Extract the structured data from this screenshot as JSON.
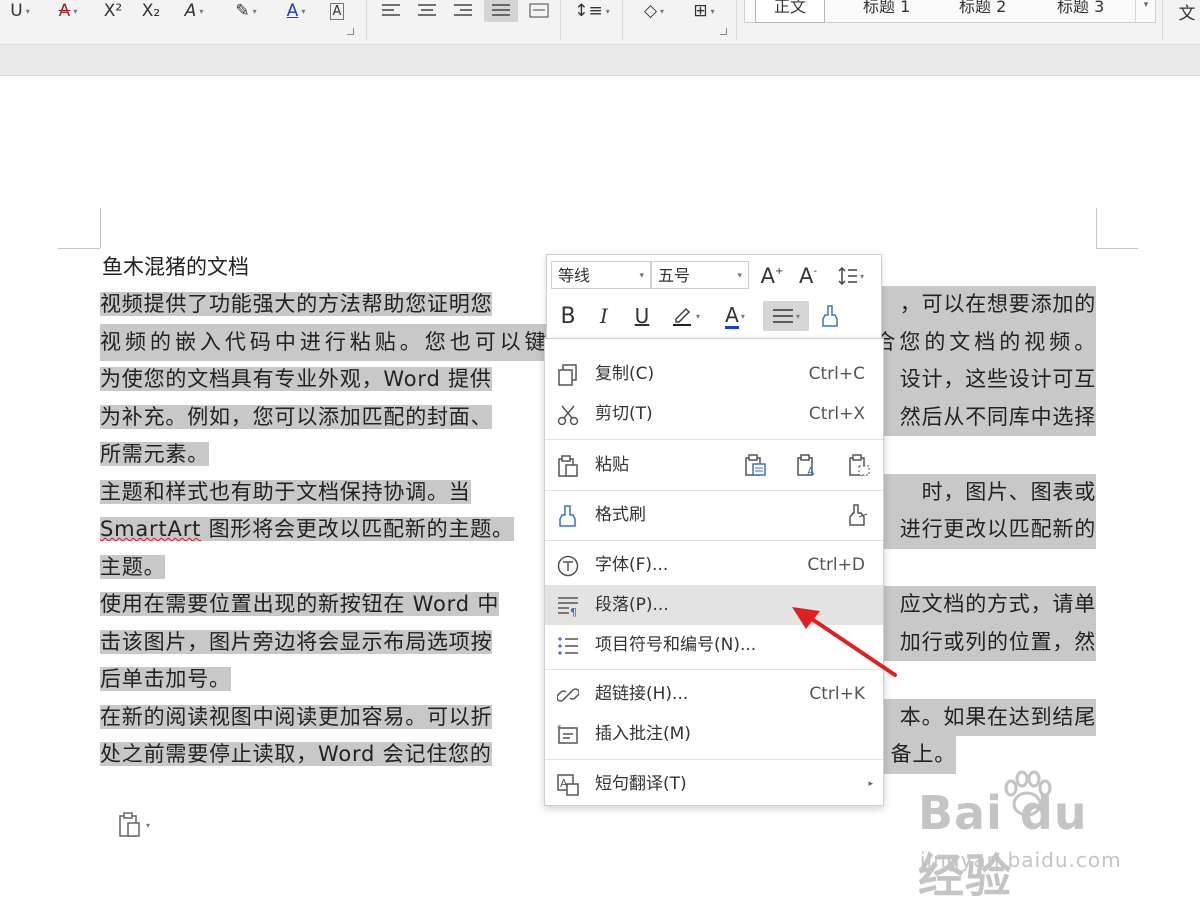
{
  "ribbon": {
    "styles": [
      "正文",
      "标题 1",
      "标题 2",
      "标题 3"
    ],
    "cut_off_label": "文"
  },
  "document": {
    "title": "鱼木混猪的文档",
    "paragraphs": [
      {
        "lines": [
          {
            "text": "视频提供了功能强大的方法帮助您证明您",
            "full": false
          },
          {
            "text": "视频的嵌入代码中进行粘贴。您也可以键入一个关键字以联机搜索最适合您的文档的视频。",
            "full": true
          },
          {
            "text": "为使您的文档具有专业外观，Word 提供",
            "full": false
          },
          {
            "text": "为补充。例如，您可以添加匹配的封面、",
            "full": false
          },
          {
            "text": "所需元素。",
            "full": false
          }
        ]
      },
      {
        "lines": [
          {
            "text": "主题和样式也有助于文档保持协调。当",
            "full": false
          },
          {
            "text": "SmartArt 图形将会更改以匹配新的主题。",
            "full": false
          },
          {
            "text": "主题。",
            "full": false
          }
        ]
      },
      {
        "lines": [
          {
            "text": "使用在需要位置出现的新按钮在 Word 中",
            "full": false
          },
          {
            "text": "击该图片，图片旁边将会显示布局选项按",
            "full": false
          },
          {
            "text": "后单击加号。",
            "full": false
          }
        ]
      },
      {
        "lines": [
          {
            "text": "在新的阅读视图中阅读更加容易。可以折",
            "full": false
          },
          {
            "text": "处之前需要停止读取，Word 会记住您的",
            "full": false
          }
        ]
      }
    ],
    "right_fragments": [
      "，可以在想要添加的",
      "设计，这些设计可互",
      "然后从不同库中选择",
      "时，图片、图表或",
      "进行更改以匹配新的",
      "应文档的方式，请单",
      "加行或列的位置，然",
      "本。如果在达到结尾",
      "备上。"
    ]
  },
  "mini_toolbar": {
    "font_name": "等线",
    "font_size": "五号",
    "bold": "B",
    "italic": "I",
    "underline": "U",
    "font_color_glyph": "A",
    "font_color": "#1a3fd6",
    "highlight_color": "#222222"
  },
  "context_menu": {
    "items": [
      {
        "label": "复制(C)",
        "shortcut": "Ctrl+C",
        "icon": "copy-icon"
      },
      {
        "label": "剪切(T)",
        "shortcut": "Ctrl+X",
        "icon": "scissors-icon"
      },
      {
        "label": "粘贴",
        "shortcut": "",
        "icon": "paste-icon"
      },
      {
        "label": "格式刷",
        "shortcut": "",
        "icon": "format-painter-icon"
      },
      {
        "label": "字体(F)...",
        "shortcut": "Ctrl+D",
        "icon": "font-icon"
      },
      {
        "label": "段落(P)...",
        "shortcut": "",
        "icon": "paragraph-icon"
      },
      {
        "label": "项目符号和编号(N)...",
        "shortcut": "",
        "icon": "bullet-list-icon"
      },
      {
        "label": "超链接(H)...",
        "shortcut": "Ctrl+K",
        "icon": "hyperlink-icon"
      },
      {
        "label": "插入批注(M)",
        "shortcut": "",
        "icon": "comment-icon"
      },
      {
        "label": "短句翻译(T)",
        "shortcut": "",
        "icon": "translate-icon"
      }
    ],
    "highlighted": "段落(P)..."
  },
  "annotation": {
    "arrow_color": "#e02020"
  },
  "watermark": {
    "brand": "Bai du 经验",
    "url": "jingyan.baidu.com"
  }
}
